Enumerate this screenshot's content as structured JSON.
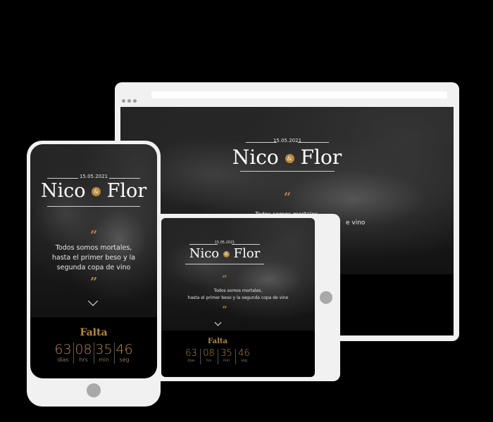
{
  "invitation": {
    "date": "15.05.2021",
    "groom": "Nico",
    "ampersand": "&",
    "bride": "Flor",
    "open_quote": "“",
    "close_quote": "”",
    "quote_line1": "Todos somos mortales,",
    "quote_line2": "hasta el primer beso y la",
    "quote_line3": "segunda copa de vino",
    "quote_tablet_line2": "hasta el primer beso y la segunda copa de vino",
    "desktop_quote_line1": "Todos somos mortales,",
    "desktop_quote_tail": "e vino",
    "countdown_title": "Falta",
    "countdown": [
      {
        "value": "63",
        "label": "dias"
      },
      {
        "value": "08",
        "label": "hrs"
      },
      {
        "value": "35",
        "label": "min"
      },
      {
        "value": "46",
        "label": "seg"
      }
    ]
  },
  "colors": {
    "accent": "#b8893d",
    "device_frame": "#f1f1f1",
    "countdown_bg": "#000000"
  },
  "icons": [
    "browser-dots-icon",
    "chevron-down-icon",
    "home-button-icon"
  ]
}
